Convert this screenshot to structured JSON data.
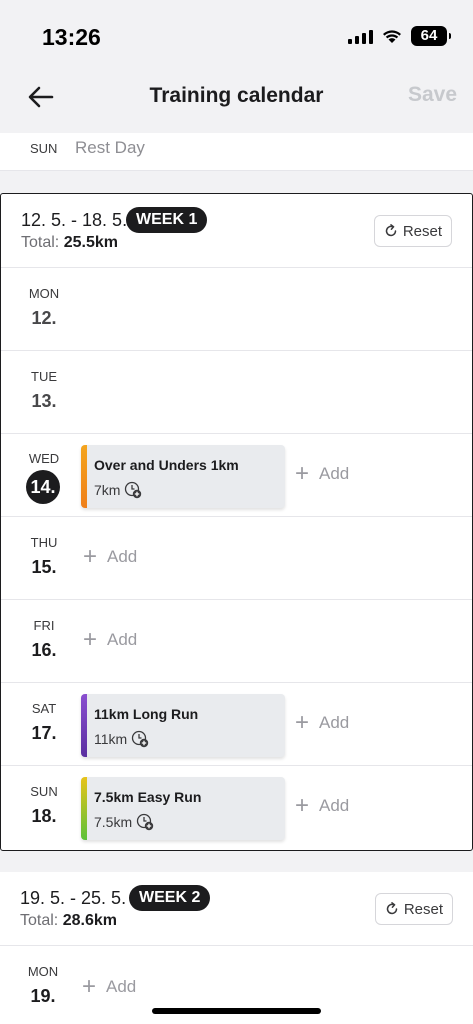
{
  "status": {
    "time": "13:26",
    "battery": "64"
  },
  "header": {
    "title": "Training calendar",
    "save_label": "Save",
    "back_icon": "arrow-left-icon"
  },
  "prev": {
    "dow": "SUN",
    "label": "Rest Day"
  },
  "weeks": [
    {
      "range": "12. 5. - 18. 5.",
      "badge": "WEEK 1",
      "total_label": "Total:",
      "total_value": "25.5km",
      "reset_label": "Reset",
      "days": [
        {
          "dow": "MON",
          "num": "12."
        },
        {
          "dow": "TUE",
          "num": "13."
        },
        {
          "dow": "WED",
          "num": "14.",
          "workout": {
            "title": "Over and Unders 1km",
            "distance": "7km",
            "color": "#f0a020"
          },
          "add": "Add"
        },
        {
          "dow": "THU",
          "num": "15.",
          "add": "Add"
        },
        {
          "dow": "FRI",
          "num": "16.",
          "add": "Add"
        },
        {
          "dow": "SAT",
          "num": "17.",
          "workout": {
            "title": "11km Long Run",
            "distance": "11km",
            "color": "#6a3fb5"
          },
          "add": "Add"
        },
        {
          "dow": "SUN",
          "num": "18.",
          "workout": {
            "title": "7.5km Easy Run",
            "distance": "7.5km",
            "color": "#e8c31a"
          },
          "add": "Add"
        }
      ]
    },
    {
      "range": "19. 5. - 25. 5.",
      "badge": "WEEK 2",
      "total_label": "Total:",
      "total_value": "28.6km",
      "reset_label": "Reset",
      "days": [
        {
          "dow": "MON",
          "num": "19.",
          "add": "Add"
        }
      ]
    }
  ]
}
